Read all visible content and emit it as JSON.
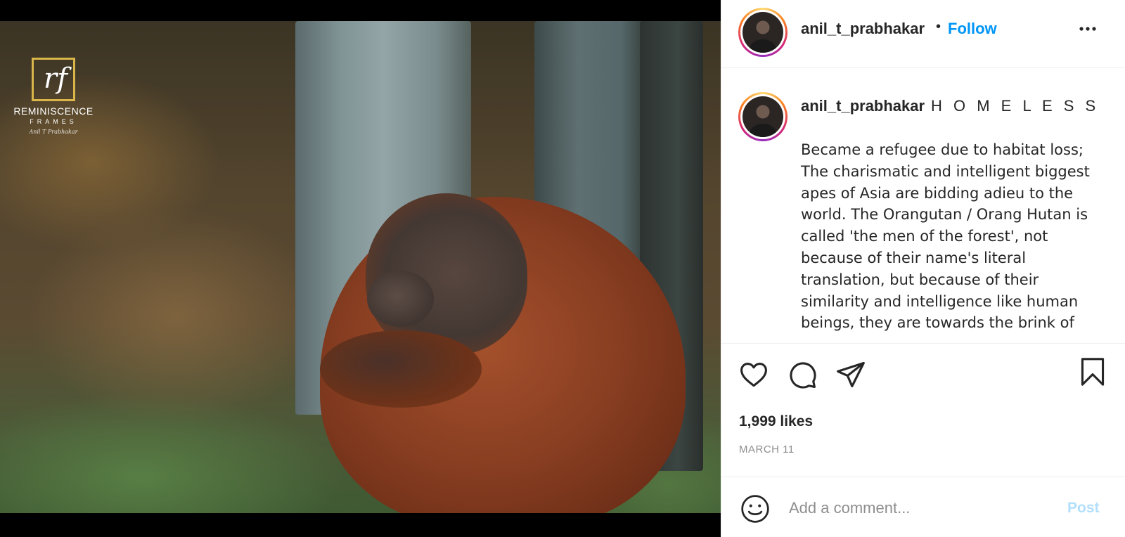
{
  "header": {
    "username": "anil_t_prabhakar",
    "separator": "•",
    "follow_label": "Follow",
    "avatar_icon": "profile-avatar",
    "more_icon": "more-options-icon"
  },
  "photo": {
    "watermark": {
      "monogram": "rf",
      "name": "REMINISCENCE",
      "subtitle": "FRAMES",
      "signature": "Anil T Prabhakar"
    }
  },
  "caption": {
    "username": "anil_t_prabhakar",
    "title": "H O M E L E S S",
    "text": "Became a refugee due to habitat loss; The charismatic and intelligent biggest apes of Asia are bidding adieu to the world. The Orangutan / Orang Hutan is called 'the men of the forest', not because of their name's literal translation, but because of their similarity and intelligence like human beings, they are towards the brink of"
  },
  "actions": {
    "like_icon": "heart-icon",
    "comment_icon": "comment-icon",
    "share_icon": "paper-plane-icon",
    "save_icon": "bookmark-icon",
    "likes": "1,999 likes",
    "date": "MARCH 11"
  },
  "comment": {
    "emoji_icon": "emoji-icon",
    "placeholder": "Add a comment...",
    "post_label": "Post"
  },
  "colors": {
    "follow": "#0095f6",
    "post_disabled": "#b2dffc",
    "muted": "#8e8e8e",
    "text": "#262626"
  }
}
